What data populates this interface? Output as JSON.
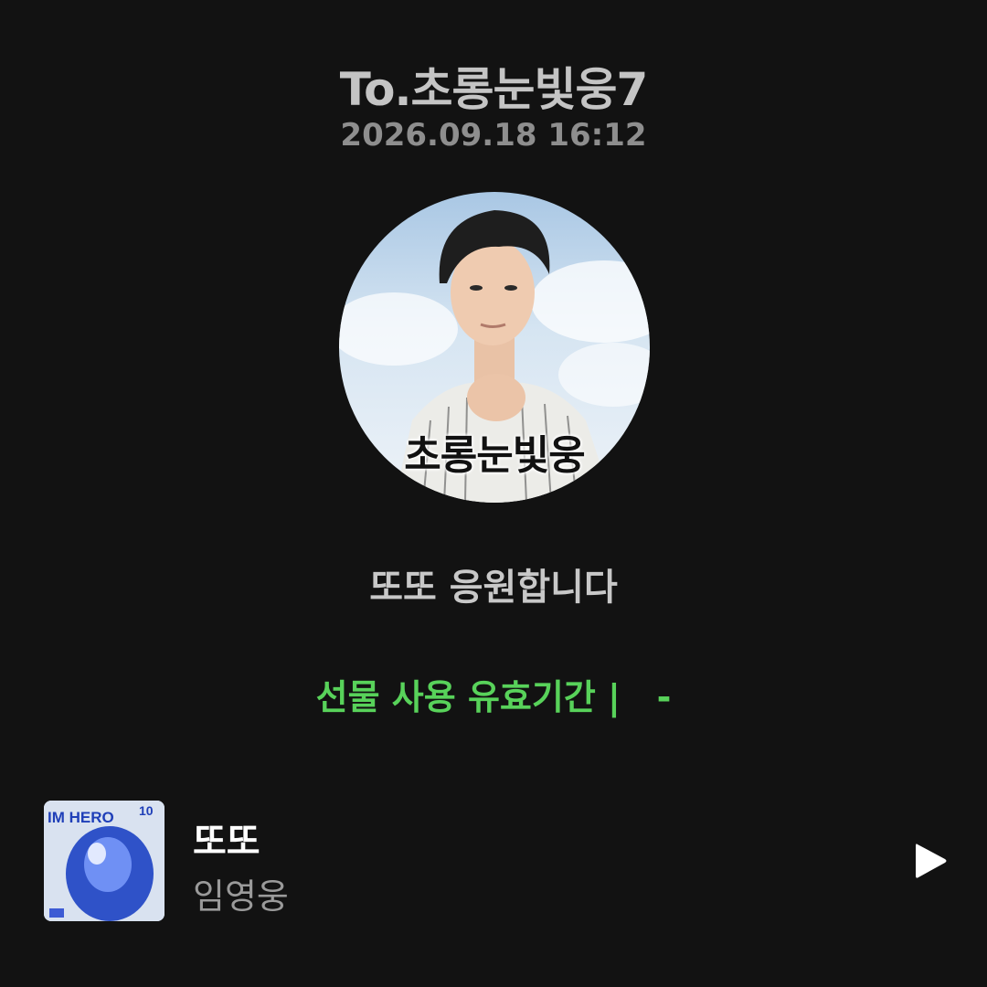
{
  "header": {
    "recipient": "To.초롱눈빛웅7",
    "timestamp": "2026.09.18 16:12"
  },
  "profile": {
    "caption": "초롱눈빛웅"
  },
  "message": {
    "text": "또또 응원합니다"
  },
  "gift": {
    "validity": "선물 사용 유효기간 |   -",
    "accent_color": "#58d25a"
  },
  "track": {
    "title": "또또",
    "artist": "임영웅",
    "cover": {
      "text_top": "IM HERO",
      "text_right": "10"
    },
    "play_icon": "play-icon"
  }
}
